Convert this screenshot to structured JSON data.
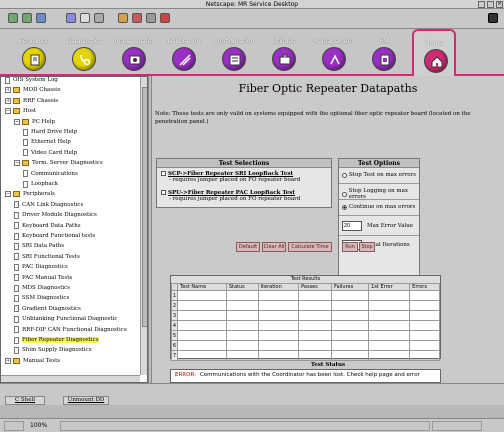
{
  "window": {
    "title": "Netscape: MR Service Desktop"
  },
  "nav": {
    "items": [
      {
        "label": "Error Logs",
        "color": "#e5d400",
        "icon": "log-icon"
      },
      {
        "label": "Diagnostics",
        "color": "#e5d400",
        "icon": "stethoscope-icon"
      },
      {
        "label": "Image Quality",
        "color": "#9a2fc4",
        "icon": "image-quality-icon"
      },
      {
        "label": "Calibration",
        "color": "#9a2fc4",
        "icon": "calibration-icon"
      },
      {
        "label": "Configuration",
        "color": "#9a2fc4",
        "icon": "configuration-icon"
      },
      {
        "label": "Utilities",
        "color": "#9a2fc4",
        "icon": "utilities-icon"
      },
      {
        "label": "Replacement",
        "color": "#9a2fc4",
        "icon": "replacement-icon"
      },
      {
        "label": "PM",
        "color": "#9a2fc4",
        "icon": "pm-icon"
      },
      {
        "label": "Home",
        "color": "#d12b76",
        "icon": "home-icon"
      }
    ],
    "active_color": "#d12b76"
  },
  "tree": {
    "items": [
      {
        "label": "OIS System Log",
        "type": "doc",
        "level": 0,
        "exp": ""
      },
      {
        "label": "MOD Chassis",
        "type": "folder",
        "level": 0,
        "exp": "+"
      },
      {
        "label": "RRF Chassis",
        "type": "folder",
        "level": 0,
        "exp": "+"
      },
      {
        "label": "Host",
        "type": "folder",
        "level": 0,
        "exp": "−"
      },
      {
        "label": "PC Help",
        "type": "folder",
        "level": 1,
        "exp": "−"
      },
      {
        "label": "Hard Drive Help",
        "type": "doc",
        "level": 2,
        "exp": ""
      },
      {
        "label": "Ethernet Help",
        "type": "doc",
        "level": 2,
        "exp": ""
      },
      {
        "label": "Video Card Help",
        "type": "doc",
        "level": 2,
        "exp": ""
      },
      {
        "label": "Term. Server Diagnostics",
        "type": "folder",
        "level": 1,
        "exp": "−"
      },
      {
        "label": "Communications",
        "type": "doc",
        "level": 2,
        "exp": ""
      },
      {
        "label": "Loopback",
        "type": "doc",
        "level": 2,
        "exp": ""
      },
      {
        "label": "Peripherals",
        "type": "folder",
        "level": 0,
        "exp": "−"
      },
      {
        "label": "CAN Link Diagnostics",
        "type": "doc",
        "level": 1,
        "exp": ""
      },
      {
        "label": "Driver Module Diagnostics",
        "type": "doc",
        "level": 1,
        "exp": ""
      },
      {
        "label": "Keyboard Data Paths",
        "type": "doc",
        "level": 1,
        "exp": ""
      },
      {
        "label": "Keyboard Functional tests",
        "type": "doc",
        "level": 1,
        "exp": ""
      },
      {
        "label": "SRI Data Paths",
        "type": "doc",
        "level": 1,
        "exp": ""
      },
      {
        "label": "SRI Functional Tests",
        "type": "doc",
        "level": 1,
        "exp": ""
      },
      {
        "label": "PAC Diagnostics",
        "type": "doc",
        "level": 1,
        "exp": ""
      },
      {
        "label": "PAC Manual Tests",
        "type": "doc",
        "level": 1,
        "exp": ""
      },
      {
        "label": "MDS Diagnostics",
        "type": "doc",
        "level": 1,
        "exp": ""
      },
      {
        "label": "SSM Diagnostics",
        "type": "doc",
        "level": 1,
        "exp": ""
      },
      {
        "label": "Gradient Diagnostics",
        "type": "doc",
        "level": 1,
        "exp": ""
      },
      {
        "label": "Unblanking Functional Diagnostic",
        "type": "doc",
        "level": 1,
        "exp": ""
      },
      {
        "label": "RRF-DIF CAN Functional Diagnostics",
        "type": "doc",
        "level": 1,
        "exp": ""
      },
      {
        "label": "Fiber Repeater Diagnostics",
        "type": "doc",
        "level": 1,
        "exp": "",
        "selected": true
      },
      {
        "label": "Shim Supply Diagnostics",
        "type": "doc",
        "level": 1,
        "exp": ""
      },
      {
        "label": "Manual Tests",
        "type": "folder",
        "level": 0,
        "exp": "+"
      }
    ]
  },
  "page": {
    "title": "Fiber Optic Repeater Datapaths",
    "note": "Note: These tests are only valid on systems equipped with the optional fiber optic repeater board (located on the penetration panel.)"
  },
  "test_selections": {
    "header": "Test Selections",
    "tests": [
      {
        "name": "SCP->Fiber Repeater SRI LoopBack Test",
        "sub": "- requires jumper placed on FO repeater board"
      },
      {
        "name": "SPU->Fiber Repeater PAC LoopBack Test",
        "sub": "- requires jumper placed on FO repeater board"
      }
    ]
  },
  "test_options": {
    "header": "Test Options",
    "radios": [
      {
        "label": "Stop Test on max errors",
        "checked": false
      },
      {
        "label": "Stop Logging on max errors",
        "checked": false
      },
      {
        "label": "Continue on max errors",
        "checked": true
      }
    ],
    "max_errors_value": "20",
    "max_errors_label": "Max Error Value",
    "iterations_value": "1",
    "iterations_label": "Total Iterations"
  },
  "buttons": {
    "default": "Default",
    "clear_all": "Clear All",
    "calc_time": "Calculate Time",
    "run": "Run",
    "stop": "Stop"
  },
  "results": {
    "title": "Test Results",
    "columns": [
      "Test Name",
      "Status",
      "Iteration",
      "Passes",
      "Failures",
      "1st Error",
      "Errors"
    ],
    "rows": [
      "1",
      "2",
      "3",
      "4",
      "5",
      "6",
      "7"
    ]
  },
  "status": {
    "label": "Test Status",
    "prefix": "ERROR:",
    "message": "Communications with the Coordinator has been lost.  Check help page and error"
  },
  "bottom_tabs": {
    "shell": "C Shell",
    "unmount": "Unmount DD"
  },
  "statusbar": {
    "progress": "100%"
  }
}
